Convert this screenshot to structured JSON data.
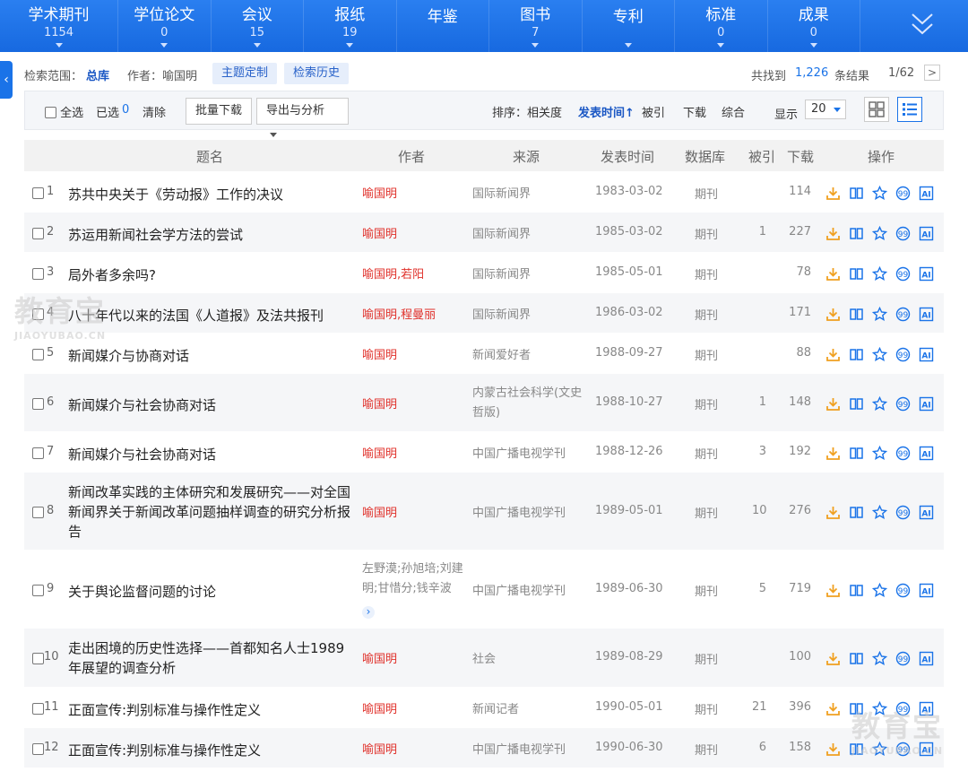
{
  "categories": [
    {
      "name": "学术期刊",
      "count": "1154"
    },
    {
      "name": "学位论文",
      "count": "0"
    },
    {
      "name": "会议",
      "count": "15"
    },
    {
      "name": "报纸",
      "count": "19"
    },
    {
      "name": "年鉴",
      "count": ""
    },
    {
      "name": "图书",
      "count": "7"
    },
    {
      "name": "专利",
      "count": ""
    },
    {
      "name": "标准",
      "count": "0"
    },
    {
      "name": "成果",
      "count": "0"
    }
  ],
  "search": {
    "scope_label": "检索范围：",
    "scope_value": "总库",
    "author_query": "作者：喻国明",
    "theme_btn": "主题定制",
    "history_btn": "检索历史",
    "found_prefix": "共找到",
    "found_count": "1,226",
    "found_suffix": "条结果",
    "page_info": "1/62",
    "next_page": ">"
  },
  "toolbar": {
    "select_all": "全选",
    "selected_label": "已选",
    "selected_count": "0",
    "clear": "清除",
    "batch_download": "批量下载",
    "export": "导出与分析",
    "sort_label": "排序：",
    "sort_relevance": "相关度",
    "sort_date": "发表时间",
    "sort_cited": "被引",
    "sort_download": "下载",
    "sort_composite": "综合",
    "display_label": "显示",
    "display_value": "20"
  },
  "table": {
    "headers": {
      "title": "题名",
      "author": "作者",
      "source": "来源",
      "date": "发表时间",
      "db": "数据库",
      "cite": "被引",
      "dl": "下载",
      "ops": "操作"
    },
    "rows": [
      {
        "num": "1",
        "title": "苏共中央关于《劳动报》工作的决议",
        "author": "喻国明",
        "source": "国际新闻界",
        "date": "1983-03-02",
        "db": "期刊",
        "cite": "",
        "dl": "114"
      },
      {
        "num": "2",
        "title": "苏运用新闻社会学方法的尝试",
        "author": "喻国明",
        "source": "国际新闻界",
        "date": "1985-03-02",
        "db": "期刊",
        "cite": "1",
        "dl": "227"
      },
      {
        "num": "3",
        "title": "局外者多余吗?",
        "author": "喻国明,若阳",
        "source": "国际新闻界",
        "date": "1985-05-01",
        "db": "期刊",
        "cite": "",
        "dl": "78"
      },
      {
        "num": "4",
        "title": "八十年代以来的法国《人道报》及法共报刊",
        "author": "喻国明,程曼丽",
        "source": "国际新闻界",
        "date": "1986-03-02",
        "db": "期刊",
        "cite": "",
        "dl": "171"
      },
      {
        "num": "5",
        "title": "新闻媒介与协商对话",
        "author": "喻国明",
        "source": "新闻爱好者",
        "date": "1988-09-27",
        "db": "期刊",
        "cite": "",
        "dl": "88"
      },
      {
        "num": "6",
        "title": "新闻媒介与社会协商对话",
        "author": "喻国明",
        "source": "内蒙古社会科学(文史哲版)",
        "date": "1988-10-27",
        "db": "期刊",
        "cite": "1",
        "dl": "148"
      },
      {
        "num": "7",
        "title": "新闻媒介与社会协商对话",
        "author": "喻国明",
        "source": "中国广播电视学刊",
        "date": "1988-12-26",
        "db": "期刊",
        "cite": "3",
        "dl": "192"
      },
      {
        "num": "8",
        "title": "新闻改革实践的主体研究和发展研究——对全国新闻界关于新闻改革问题抽样调查的研究分析报告",
        "author": "喻国明",
        "source": "中国广播电视学刊",
        "date": "1989-05-01",
        "db": "期刊",
        "cite": "10",
        "dl": "276"
      },
      {
        "num": "9",
        "title": "关于舆论监督问题的讨论",
        "author": "左野漠;孙旭培;刘建明;甘惜分;钱辛波",
        "source": "中国广播电视学刊",
        "date": "1989-06-30",
        "db": "期刊",
        "cite": "5",
        "dl": "719"
      },
      {
        "num": "10",
        "title": "走出困境的历史性选择——首都知名人士1989年展望的调查分析",
        "author": "喻国明",
        "source": "社会",
        "date": "1989-08-29",
        "db": "期刊",
        "cite": "",
        "dl": "100"
      },
      {
        "num": "11",
        "title": "正面宣传:判别标准与操作性定义",
        "author": "喻国明",
        "source": "新闻记者",
        "date": "1990-05-01",
        "db": "期刊",
        "cite": "21",
        "dl": "396"
      },
      {
        "num": "12",
        "title": "正面宣传:判别标准与操作性定义",
        "author": "喻国明",
        "source": "中国广播电视学刊",
        "date": "1990-06-30",
        "db": "期刊",
        "cite": "6",
        "dl": "158"
      }
    ]
  },
  "ops_icons": [
    "download-icon",
    "read-icon",
    "favorite-icon",
    "cite-icon",
    "ai-icon"
  ],
  "watermark": {
    "cn": "教育宝",
    "en": "JIAOYUBAO.CN"
  },
  "colors": {
    "brand": "#1a73e8",
    "author_red": "#e0302a",
    "icon_orange": "#f0a020"
  }
}
